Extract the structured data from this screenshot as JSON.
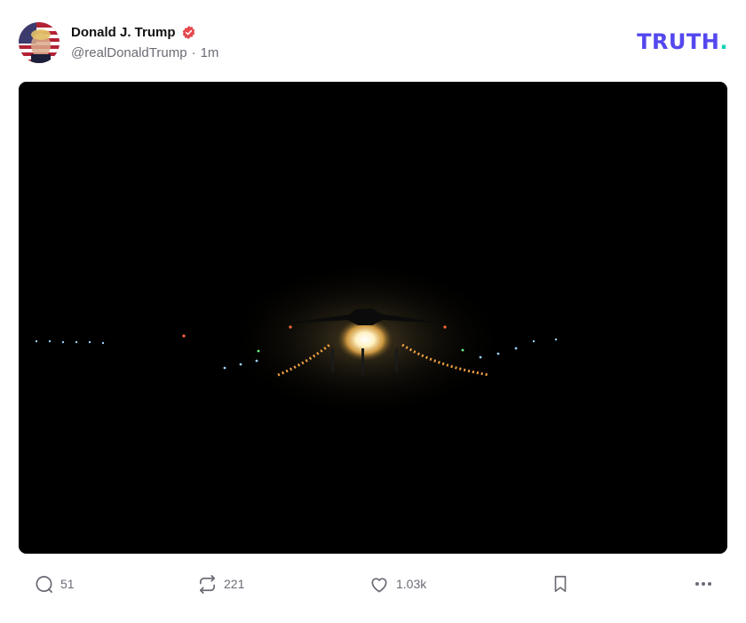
{
  "post": {
    "author": {
      "display_name": "Donald J. Trump",
      "verified": true,
      "verified_icon": "verified-badge-icon",
      "handle": "@realDonaldTrump",
      "separator": "·",
      "time": "1m"
    },
    "brand": {
      "logo_text": "TRUTH",
      "logo_dot": ".",
      "logo_color": "#5448ee",
      "dot_color": "#17d2b7"
    },
    "media": {
      "kind": "image",
      "background_color": "#000000"
    },
    "actions": {
      "reply": {
        "icon": "reply-icon",
        "count": "51"
      },
      "retruth": {
        "icon": "retruth-icon",
        "count": "221"
      },
      "like": {
        "icon": "heart-icon",
        "count": "1.03k"
      },
      "bookmark": {
        "icon": "bookmark-icon"
      },
      "more": {
        "icon": "more-icon"
      }
    },
    "colors": {
      "name": "#111111",
      "meta": "#6b6b76",
      "verified": "#e5484d"
    }
  }
}
